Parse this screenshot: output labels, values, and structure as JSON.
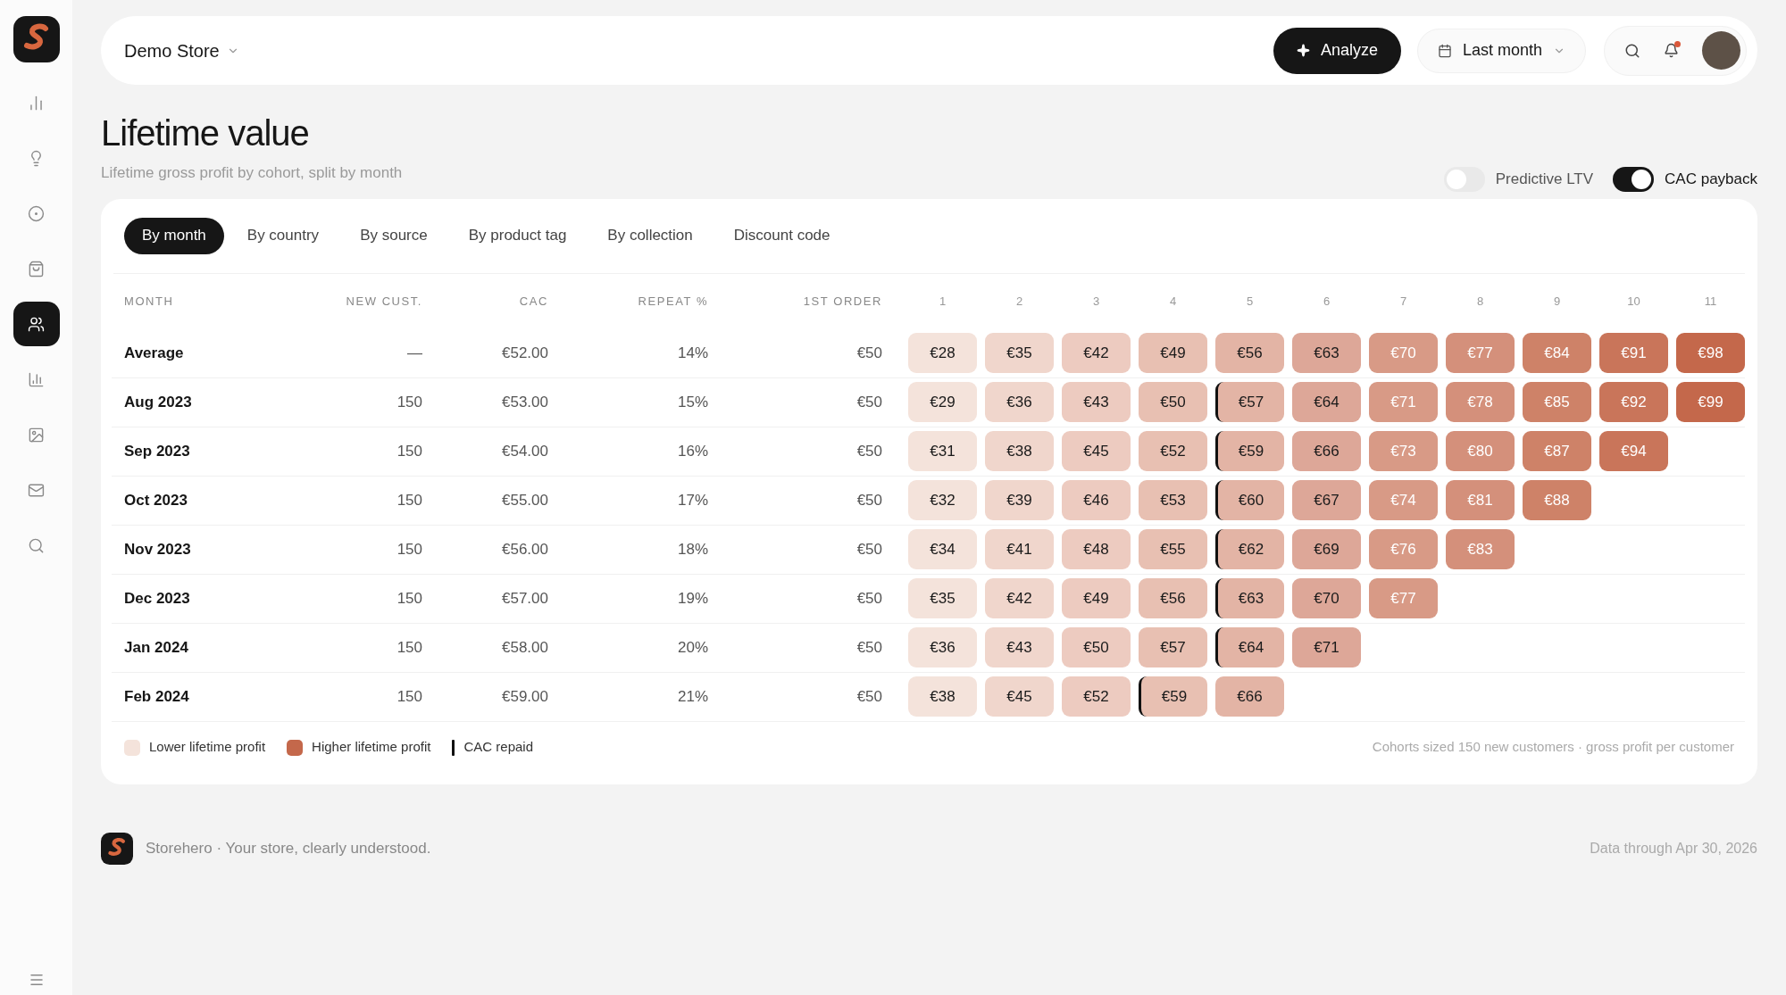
{
  "sidebar": {
    "items": [
      {
        "kind": "bars",
        "selected": false
      },
      {
        "kind": "bulb",
        "selected": false
      },
      {
        "kind": "target",
        "selected": false
      },
      {
        "kind": "bag",
        "selected": false
      },
      {
        "kind": "people",
        "selected": true
      },
      {
        "kind": "chart",
        "selected": false
      },
      {
        "kind": "image",
        "selected": false
      },
      {
        "kind": "mail",
        "selected": false
      },
      {
        "kind": "search",
        "selected": false
      }
    ]
  },
  "header": {
    "store": "Demo Store",
    "analyze": "Analyze",
    "period": "Last month",
    "notification": true
  },
  "page": {
    "title": "Lifetime value",
    "subtitle": "Lifetime gross profit by cohort, split by month"
  },
  "toggles": [
    {
      "label": "Predictive LTV",
      "on": false
    },
    {
      "label": "CAC payback",
      "on": true
    }
  ],
  "tabs": [
    {
      "label": "By month",
      "selected": true
    },
    {
      "label": "By country",
      "selected": false
    },
    {
      "label": "By source",
      "selected": false
    },
    {
      "label": "By product tag",
      "selected": false
    },
    {
      "label": "By collection",
      "selected": false
    },
    {
      "label": "Discount code",
      "selected": false
    }
  ],
  "table": {
    "columns": [
      "MONTH",
      "NEW CUST.",
      "CAC",
      "REPEAT %",
      "1ST ORDER"
    ],
    "month_columns": [
      "1",
      "2",
      "3",
      "4",
      "5",
      "6",
      "7",
      "8",
      "9",
      "10",
      "11"
    ],
    "rows": [
      {
        "month": "Average",
        "new_cust": "—",
        "cac": "€52.00",
        "repeat": "14%",
        "first_order": "€50",
        "cells": [
          {
            "value": "€28",
            "color": "#f4e3db",
            "cac_repaid": false
          },
          {
            "value": "€35",
            "color": "#f0d6cc",
            "cac_repaid": false
          },
          {
            "value": "€42",
            "color": "#edcbc0",
            "cac_repaid": false
          },
          {
            "value": "€49",
            "color": "#e8c0b2",
            "cac_repaid": false
          },
          {
            "value": "€56",
            "color": "#e3b4a5",
            "cac_repaid": false
          },
          {
            "value": "€63",
            "color": "#dda798",
            "cac_repaid": false
          },
          {
            "value": "€70",
            "color": "#d89a86",
            "cac_repaid": false
          },
          {
            "value": "€77",
            "color": "#d4907b",
            "cac_repaid": false
          },
          {
            "value": "€84",
            "color": "#ce8268",
            "cac_repaid": false
          },
          {
            "value": "€91",
            "color": "#c9755a",
            "cac_repaid": false
          },
          {
            "value": "€98",
            "color": "#c4684b",
            "cac_repaid": false
          }
        ]
      },
      {
        "month": "Aug 2023",
        "new_cust": "150",
        "cac": "€53.00",
        "repeat": "15%",
        "first_order": "€50",
        "cells": [
          {
            "value": "€29",
            "color": "#f4e3db",
            "cac_repaid": false
          },
          {
            "value": "€36",
            "color": "#f0d6cc",
            "cac_repaid": false
          },
          {
            "value": "€43",
            "color": "#edcbc0",
            "cac_repaid": false
          },
          {
            "value": "€50",
            "color": "#e8c0b2",
            "cac_repaid": false
          },
          {
            "value": "€57",
            "color": "#e3b4a5",
            "cac_repaid": true
          },
          {
            "value": "€64",
            "color": "#dda798",
            "cac_repaid": false
          },
          {
            "value": "€71",
            "color": "#d89a86",
            "cac_repaid": false
          },
          {
            "value": "€78",
            "color": "#d4907b",
            "cac_repaid": false
          },
          {
            "value": "€85",
            "color": "#ce8268",
            "cac_repaid": false
          },
          {
            "value": "€92",
            "color": "#c9755a",
            "cac_repaid": false
          },
          {
            "value": "€99",
            "color": "#c4684b",
            "cac_repaid": false
          }
        ]
      },
      {
        "month": "Sep 2023",
        "new_cust": "150",
        "cac": "€54.00",
        "repeat": "16%",
        "first_order": "€50",
        "cells": [
          {
            "value": "€31",
            "color": "#f4e3db",
            "cac_repaid": false
          },
          {
            "value": "€38",
            "color": "#f0d6cc",
            "cac_repaid": false
          },
          {
            "value": "€45",
            "color": "#edcbc0",
            "cac_repaid": false
          },
          {
            "value": "€52",
            "color": "#e8c0b2",
            "cac_repaid": false
          },
          {
            "value": "€59",
            "color": "#e3b4a5",
            "cac_repaid": true
          },
          {
            "value": "€66",
            "color": "#dda798",
            "cac_repaid": false
          },
          {
            "value": "€73",
            "color": "#d89a86",
            "cac_repaid": false
          },
          {
            "value": "€80",
            "color": "#d4907b",
            "cac_repaid": false
          },
          {
            "value": "€87",
            "color": "#ce8268",
            "cac_repaid": false
          },
          {
            "value": "€94",
            "color": "#c9755a",
            "cac_repaid": false
          }
        ]
      },
      {
        "month": "Oct 2023",
        "new_cust": "150",
        "cac": "€55.00",
        "repeat": "17%",
        "first_order": "€50",
        "cells": [
          {
            "value": "€32",
            "color": "#f4e3db",
            "cac_repaid": false
          },
          {
            "value": "€39",
            "color": "#f0d6cc",
            "cac_repaid": false
          },
          {
            "value": "€46",
            "color": "#edcbc0",
            "cac_repaid": false
          },
          {
            "value": "€53",
            "color": "#e8c0b2",
            "cac_repaid": false
          },
          {
            "value": "€60",
            "color": "#e3b4a5",
            "cac_repaid": true
          },
          {
            "value": "€67",
            "color": "#dda798",
            "cac_repaid": false
          },
          {
            "value": "€74",
            "color": "#d89a86",
            "cac_repaid": false
          },
          {
            "value": "€81",
            "color": "#d4907b",
            "cac_repaid": false
          },
          {
            "value": "€88",
            "color": "#ce8268",
            "cac_repaid": false
          }
        ]
      },
      {
        "month": "Nov 2023",
        "new_cust": "150",
        "cac": "€56.00",
        "repeat": "18%",
        "first_order": "€50",
        "cells": [
          {
            "value": "€34",
            "color": "#f4e3db",
            "cac_repaid": false
          },
          {
            "value": "€41",
            "color": "#f0d6cc",
            "cac_repaid": false
          },
          {
            "value": "€48",
            "color": "#edcbc0",
            "cac_repaid": false
          },
          {
            "value": "€55",
            "color": "#e8c0b2",
            "cac_repaid": false
          },
          {
            "value": "€62",
            "color": "#e3b4a5",
            "cac_repaid": true
          },
          {
            "value": "€69",
            "color": "#dda798",
            "cac_repaid": false
          },
          {
            "value": "€76",
            "color": "#d89a86",
            "cac_repaid": false
          },
          {
            "value": "€83",
            "color": "#d4907b",
            "cac_repaid": false
          }
        ]
      },
      {
        "month": "Dec 2023",
        "new_cust": "150",
        "cac": "€57.00",
        "repeat": "19%",
        "first_order": "€50",
        "cells": [
          {
            "value": "€35",
            "color": "#f4e3db",
            "cac_repaid": false
          },
          {
            "value": "€42",
            "color": "#f0d6cc",
            "cac_repaid": false
          },
          {
            "value": "€49",
            "color": "#edcbc0",
            "cac_repaid": false
          },
          {
            "value": "€56",
            "color": "#e8c0b2",
            "cac_repaid": false
          },
          {
            "value": "€63",
            "color": "#e3b4a5",
            "cac_repaid": true
          },
          {
            "value": "€70",
            "color": "#dda798",
            "cac_repaid": false
          },
          {
            "value": "€77",
            "color": "#d89a86",
            "cac_repaid": false
          }
        ]
      },
      {
        "month": "Jan 2024",
        "new_cust": "150",
        "cac": "€58.00",
        "repeat": "20%",
        "first_order": "€50",
        "cells": [
          {
            "value": "€36",
            "color": "#f4e3db",
            "cac_repaid": false
          },
          {
            "value": "€43",
            "color": "#f0d6cc",
            "cac_repaid": false
          },
          {
            "value": "€50",
            "color": "#edcbc0",
            "cac_repaid": false
          },
          {
            "value": "€57",
            "color": "#e8c0b2",
            "cac_repaid": false
          },
          {
            "value": "€64",
            "color": "#e3b4a5",
            "cac_repaid": true
          },
          {
            "value": "€71",
            "color": "#dda798",
            "cac_repaid": false
          }
        ]
      },
      {
        "month": "Feb 2024",
        "new_cust": "150",
        "cac": "€59.00",
        "repeat": "21%",
        "first_order": "€50",
        "cells": [
          {
            "value": "€38",
            "color": "#f4e3db",
            "cac_repaid": false
          },
          {
            "value": "€45",
            "color": "#f0d6cc",
            "cac_repaid": false
          },
          {
            "value": "€52",
            "color": "#edcbc0",
            "cac_repaid": false
          },
          {
            "value": "€59",
            "color": "#e8c0b2",
            "cac_repaid": true
          },
          {
            "value": "€66",
            "color": "#e3b4a5",
            "cac_repaid": false
          }
        ]
      }
    ]
  },
  "legend": [
    {
      "kind": "swatch",
      "label": "Lower lifetime profit",
      "color": "#f4e3db"
    },
    {
      "kind": "swatch",
      "label": "Higher lifetime profit",
      "color": "#c4684b"
    },
    {
      "kind": "bar",
      "label": "CAC repaid",
      "color": "#111111"
    }
  ],
  "table_note": "Cohorts sized 150 new customers · gross profit per customer",
  "footer": {
    "tagline": "Storehero · Your store, clearly understood.",
    "data_through": "Data through Apr 30, 2026"
  }
}
